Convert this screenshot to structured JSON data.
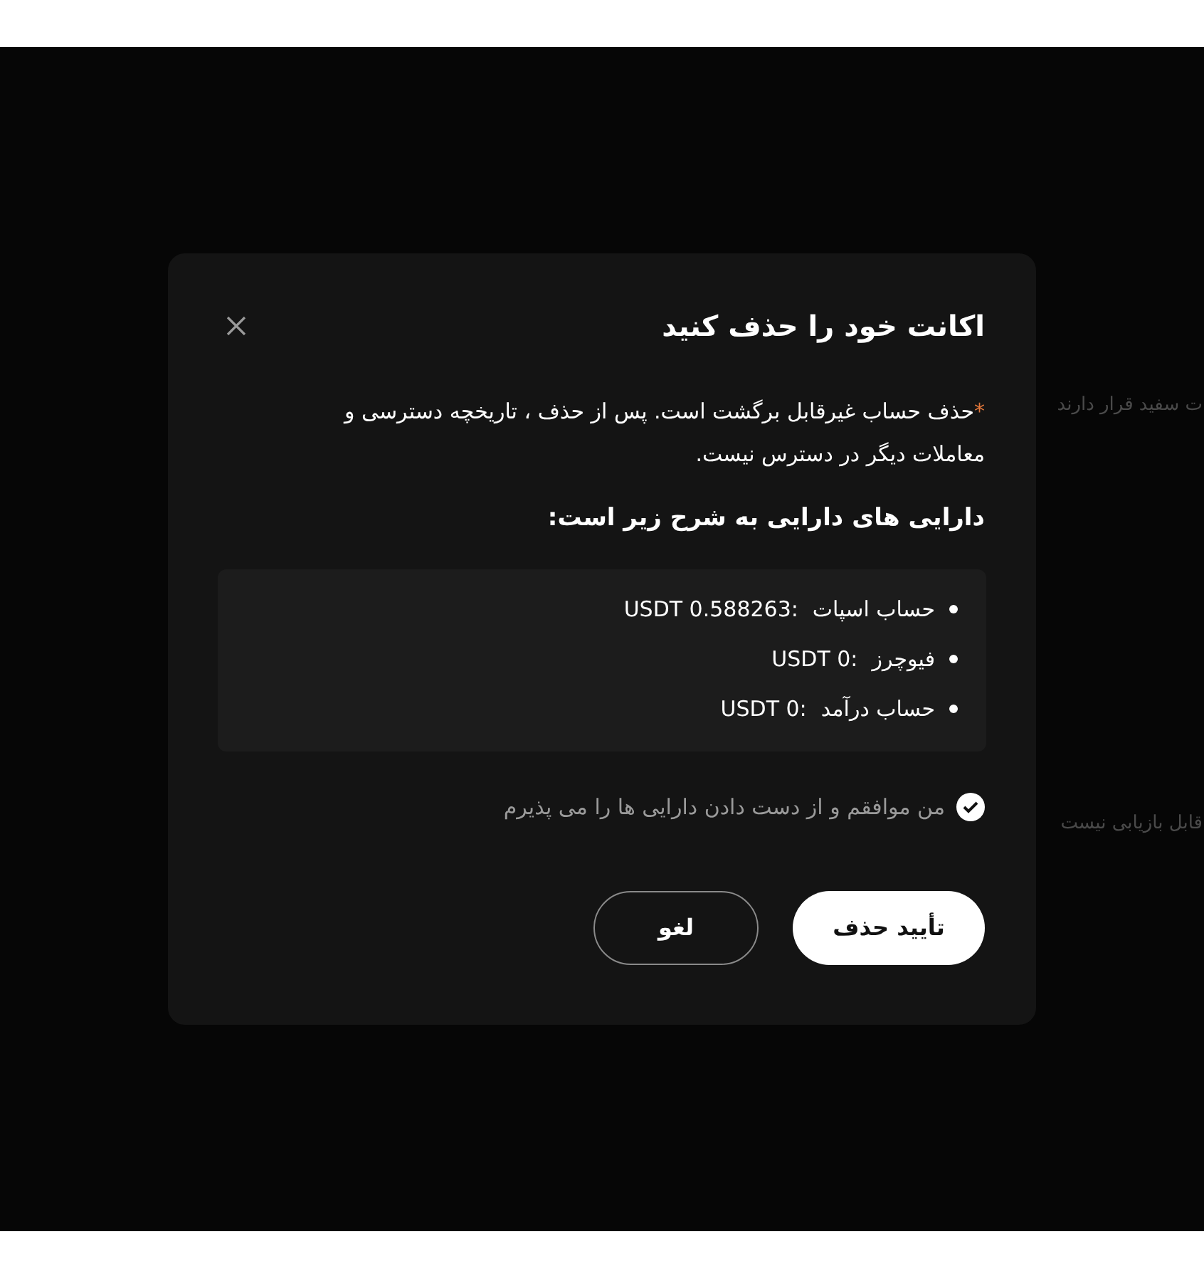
{
  "background_texts": [
    "ت سفید قرار دارند",
    "قابل بازیابی نیست"
  ],
  "dialog": {
    "title": "اکانت خود را حذف کنید",
    "warning_mark": "*",
    "warning": "حذف حساب غیرقابل برگشت است. پس از حذف ، تاریخچه دسترسی و معاملات دیگر در دسترس نیست.",
    "assets_heading": "دارایی های دارایی به شرح زیر است:",
    "assets": [
      {
        "label": "حساب اسپات",
        "value": "USDT 0.588263:"
      },
      {
        "label": "فیوچرز",
        "value": "USDT 0:"
      },
      {
        "label": "حساب درآمد",
        "value": "USDT 0:"
      }
    ],
    "agreement": {
      "label": "من موافقم و از دست دادن دارایی ها را می پذیرم",
      "checked": true
    },
    "buttons": [
      {
        "label": "تأیید حذف",
        "kind": "primary"
      },
      {
        "label": "لغو",
        "kind": "outline"
      }
    ]
  }
}
